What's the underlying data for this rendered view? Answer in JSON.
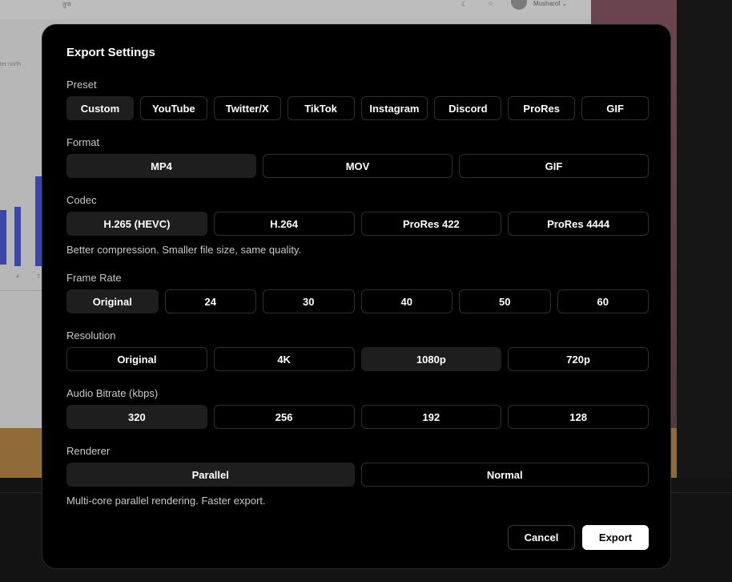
{
  "background_app": {
    "breadcrumb": "तुज",
    "side_text": "ter north",
    "username": "Musharof ⌄",
    "axis_label_a": "4",
    "axis_label_b": "T"
  },
  "modal": {
    "title": "Export Settings",
    "sections": {
      "preset": {
        "label": "Preset",
        "options": [
          "Custom",
          "YouTube",
          "Twitter/X",
          "TikTok",
          "Instagram",
          "Discord",
          "ProRes",
          "GIF"
        ],
        "selected": "Custom"
      },
      "format": {
        "label": "Format",
        "options": [
          "MP4",
          "MOV",
          "GIF"
        ],
        "selected": "MP4"
      },
      "codec": {
        "label": "Codec",
        "options": [
          "H.265 (HEVC)",
          "H.264",
          "ProRes 422",
          "ProRes 4444"
        ],
        "selected": "H.265 (HEVC)",
        "hint": "Better compression. Smaller file size, same quality."
      },
      "frame_rate": {
        "label": "Frame Rate",
        "options": [
          "Original",
          "24",
          "30",
          "40",
          "50",
          "60"
        ],
        "selected": "Original"
      },
      "resolution": {
        "label": "Resolution",
        "options": [
          "Original",
          "4K",
          "1080p",
          "720p"
        ],
        "selected": "1080p"
      },
      "audio_bitrate": {
        "label": "Audio Bitrate (kbps)",
        "options": [
          "320",
          "256",
          "192",
          "128"
        ],
        "selected": "320"
      },
      "renderer": {
        "label": "Renderer",
        "options": [
          "Parallel",
          "Normal"
        ],
        "selected": "Parallel",
        "hint": "Multi-core parallel rendering. Faster export."
      }
    },
    "buttons": {
      "cancel": "Cancel",
      "export": "Export"
    }
  },
  "colors": {
    "modal_bg": "#000000",
    "selected_option_bg": "#1e1e1e",
    "option_border": "#2f2f2f",
    "export_button_bg": "#ffffff"
  },
  "icons": {
    "theme_toggle": "moon-icon",
    "notifications": "bell-icon"
  }
}
